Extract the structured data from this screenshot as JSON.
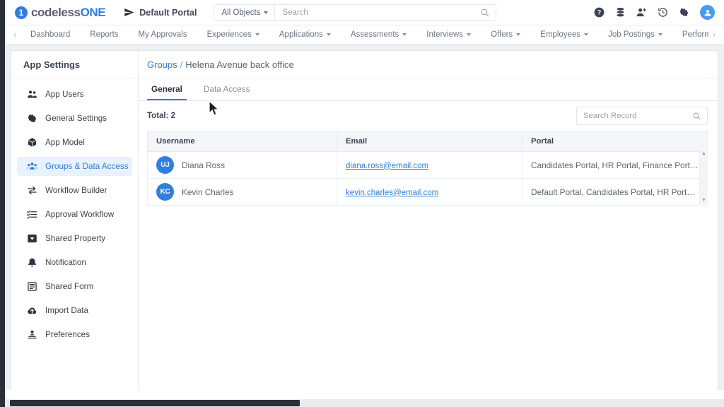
{
  "topbar": {
    "logo": {
      "mark": "1",
      "text_a": "codeless",
      "text_b": "ONE",
      "icon": "circle-one-logo"
    },
    "portal_label": "Default Portal",
    "object_filter": "All Objects",
    "search_placeholder": "Search",
    "search_value": "",
    "icons": [
      "help-icon",
      "database-icon",
      "add-user-icon",
      "history-icon",
      "gear-icon",
      "user-avatar-icon"
    ]
  },
  "nav": {
    "prev_arrow": "‹",
    "next_arrow": "›",
    "items": [
      {
        "label": "Dashboard",
        "caret": false
      },
      {
        "label": "Reports",
        "caret": false
      },
      {
        "label": "My Approvals",
        "caret": false
      },
      {
        "label": "Experiences",
        "caret": true
      },
      {
        "label": "Applications",
        "caret": true
      },
      {
        "label": "Assessments",
        "caret": true
      },
      {
        "label": "Interviews",
        "caret": true
      },
      {
        "label": "Offers",
        "caret": true
      },
      {
        "label": "Employees",
        "caret": true
      },
      {
        "label": "Job Postings",
        "caret": true
      },
      {
        "label": "Performance Reviews",
        "caret": true
      }
    ]
  },
  "sidebar": {
    "title": "App Settings",
    "items": [
      {
        "label": "App Users",
        "icon": "users-icon",
        "active": false
      },
      {
        "label": "General Settings",
        "icon": "gear-icon",
        "active": false
      },
      {
        "label": "App Model",
        "icon": "cube-icon",
        "active": false
      },
      {
        "label": "Groups & Data Access",
        "icon": "group-users-icon",
        "active": true
      },
      {
        "label": "Workflow Builder",
        "icon": "arrows-exchange-icon",
        "active": false
      },
      {
        "label": "Approval Workflow",
        "icon": "checklist-icon",
        "active": false
      },
      {
        "label": "Shared Property",
        "icon": "tag-square-icon",
        "active": false
      },
      {
        "label": "Notification",
        "icon": "bell-icon",
        "active": false
      },
      {
        "label": "Shared Form",
        "icon": "form-icon",
        "active": false
      },
      {
        "label": "Import Data",
        "icon": "cloud-upload-icon",
        "active": false
      },
      {
        "label": "Preferences",
        "icon": "person-settings-icon",
        "active": false
      }
    ]
  },
  "breadcrumb": {
    "root": "Groups",
    "separator": "/",
    "current": "Helena Avenue back office"
  },
  "tabs": [
    {
      "label": "General",
      "active": true
    },
    {
      "label": "Data Access",
      "active": false
    }
  ],
  "toolbar": {
    "total_label": "Total: 2",
    "record_search_placeholder": "Search Record",
    "record_search_value": "",
    "search_icon": "search-icon"
  },
  "table": {
    "columns": [
      "Username",
      "Email",
      "Portal"
    ],
    "rows": [
      {
        "initials": "UJ",
        "username": "Diana Ross",
        "email": "diana.ross@email.com",
        "portal": "Candidates Portal, HR Portal, Finance Portal, Manage..."
      },
      {
        "initials": "KC",
        "username": "Kevin Charles",
        "email": "kevin.charles@email.com",
        "portal": "Default Portal, Candidates Portal, HR Portal, Finance P..."
      }
    ],
    "scroll_up": "▲",
    "scroll_down": "▼"
  },
  "colors": {
    "accent": "#2f7fe0",
    "accent_soft": "#e8f1fe",
    "text": "#3d4452",
    "muted": "#8c929d",
    "border": "#e6e9ee",
    "header_bg": "#f4f6f9",
    "page_bg": "#eef0f4"
  }
}
